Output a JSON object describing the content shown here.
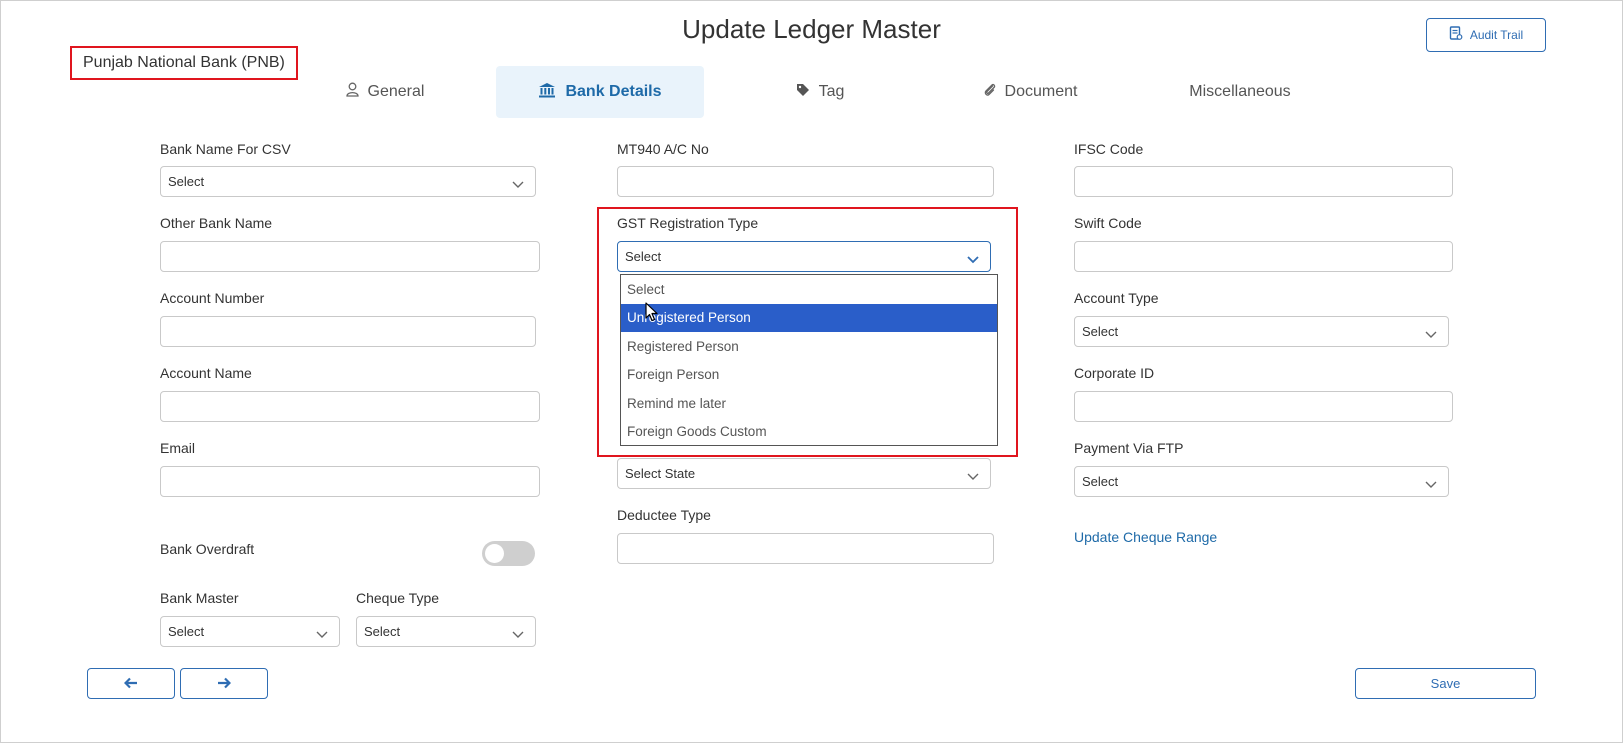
{
  "page": {
    "title": "Update Ledger Master",
    "audit_trail_label": "Audit Trail",
    "ledger_name": "Punjab National Bank (PNB)"
  },
  "tabs": [
    {
      "label": "General",
      "icon": "user-icon"
    },
    {
      "label": "Bank Details",
      "icon": "bank-icon",
      "active": true
    },
    {
      "label": "Tag",
      "icon": "tag-icon"
    },
    {
      "label": "Document",
      "icon": "paperclip-icon"
    },
    {
      "label": "Miscellaneous",
      "icon": ""
    }
  ],
  "left_column": {
    "bank_name_csv": {
      "label": "Bank Name For CSV",
      "value": "Select"
    },
    "other_bank_name": {
      "label": "Other Bank Name",
      "value": ""
    },
    "account_number": {
      "label": "Account Number",
      "value": ""
    },
    "account_name": {
      "label": "Account Name",
      "value": ""
    },
    "email": {
      "label": "Email",
      "value": ""
    },
    "bank_overdraft": {
      "label": "Bank Overdraft",
      "enabled": false
    },
    "bank_master": {
      "label": "Bank Master",
      "value": "Select"
    },
    "cheque_type": {
      "label": "Cheque Type",
      "value": "Select"
    }
  },
  "middle_column": {
    "mt940": {
      "label": "MT940 A/C No",
      "value": ""
    },
    "gst_registration_type": {
      "label": "GST Registration Type",
      "value": "Select",
      "options": [
        "Select",
        "Unregistered Person",
        "Registered Person",
        "Foreign Person",
        "Remind me later",
        "Foreign Goods Custom"
      ],
      "highlighted_option": "Unregistered Person"
    },
    "state": {
      "value": "Select State"
    },
    "deductee_type": {
      "label": "Deductee Type",
      "value": ""
    }
  },
  "right_column": {
    "ifsc": {
      "label": "IFSC Code",
      "value": ""
    },
    "swift": {
      "label": "Swift Code",
      "value": ""
    },
    "account_type": {
      "label": "Account Type",
      "value": "Select"
    },
    "corporate_id": {
      "label": "Corporate ID",
      "value": ""
    },
    "payment_via_ftp": {
      "label": "Payment Via FTP",
      "value": "Select"
    },
    "update_cheque_range": "Update Cheque Range"
  },
  "footer": {
    "prev_icon": "arrow-left-icon",
    "next_icon": "arrow-right-icon",
    "save_label": "Save"
  },
  "colors": {
    "accent": "#2f6db3",
    "highlight_red": "#e0151e",
    "active_tab_bg": "#e9f3fb",
    "dropdown_highlight": "#2a5ec9"
  }
}
